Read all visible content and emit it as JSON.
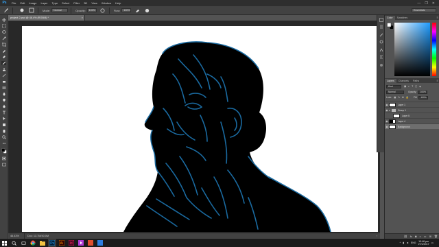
{
  "app": {
    "logo": "Ps",
    "menu": [
      "File",
      "Edit",
      "Image",
      "Layer",
      "Type",
      "Select",
      "Filter",
      "3D",
      "View",
      "Window",
      "Help"
    ],
    "window_controls": [
      "—",
      "❐",
      "✕"
    ]
  },
  "options_bar": {
    "mode_label": "Mode:",
    "mode_value": "Normal",
    "opacity_label": "Opacity:",
    "opacity_value": "100%",
    "flow_label": "Flow:",
    "flow_value": "100%",
    "workspace": "Essentials"
  },
  "document": {
    "tab_title": "project 2.psd @ 46.4% (RGB/8) *",
    "zoom": "46.43%",
    "doc_info": "Doc: 13.7M/40.0M"
  },
  "panels": {
    "color_tabs": [
      "Color",
      "Swatches"
    ],
    "layer_tabs": [
      "Layers",
      "Channels",
      "Paths"
    ],
    "kind_filter": "Kind",
    "blend_mode": "Normal",
    "opacity_label": "Opacity:",
    "opacity_value": "100%",
    "lock_label": "Lock:",
    "fill_label": "Fill:",
    "fill_value": "100%",
    "layers": [
      {
        "name": "Layer 1",
        "type": "layer",
        "visible": true
      },
      {
        "name": "Group 1",
        "type": "group",
        "visible": true
      },
      {
        "name": "Layer 5",
        "type": "layer",
        "visible": false
      },
      {
        "name": "Layer 4",
        "type": "layer",
        "visible": true
      },
      {
        "name": "Background",
        "type": "layer",
        "visible": true
      }
    ]
  },
  "taskbar": {
    "language": "ENG",
    "time": "10:46 pm",
    "date": "27/1/2017"
  },
  "colors": {
    "app_bg": "#535353",
    "menu_bg": "#2e2e2e",
    "accent_ps": "#31a8ff",
    "stroke_blue": "#1a6aa0"
  }
}
